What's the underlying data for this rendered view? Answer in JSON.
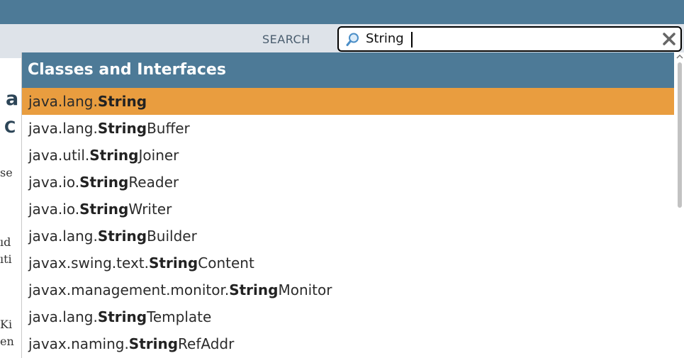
{
  "search": {
    "label": "SEARCH",
    "value": "String"
  },
  "background_fragments": {
    "heading1": "a",
    "heading2": "C",
    "line1": "se",
    "line2": "ıd",
    "line3": "ıti",
    "line4": "Ki",
    "line5": "en"
  },
  "dropdown": {
    "header": "Classes and Interfaces",
    "items": [
      {
        "prefix": "java.lang.",
        "match": "String",
        "suffix": ""
      },
      {
        "prefix": "java.lang.",
        "match": "String",
        "suffix": "Buffer"
      },
      {
        "prefix": "java.util.",
        "match": "String",
        "suffix": "Joiner"
      },
      {
        "prefix": "java.io.",
        "match": "String",
        "suffix": "Reader"
      },
      {
        "prefix": "java.io.",
        "match": "String",
        "suffix": "Writer"
      },
      {
        "prefix": "java.lang.",
        "match": "String",
        "suffix": "Builder"
      },
      {
        "prefix": "javax.swing.text.",
        "match": "String",
        "suffix": "Content"
      },
      {
        "prefix": "javax.management.monitor.",
        "match": "String",
        "suffix": "Monitor"
      },
      {
        "prefix": "java.lang.",
        "match": "String",
        "suffix": "Template"
      },
      {
        "prefix": "javax.naming.",
        "match": "String",
        "suffix": "RefAddr"
      }
    ]
  },
  "colors": {
    "header_bar": "#4d7a97",
    "sub_bar": "#dee3e9",
    "selected_item": "#e99d3f"
  },
  "icons": {
    "search": "magnifier-icon",
    "clear": "close-icon"
  }
}
